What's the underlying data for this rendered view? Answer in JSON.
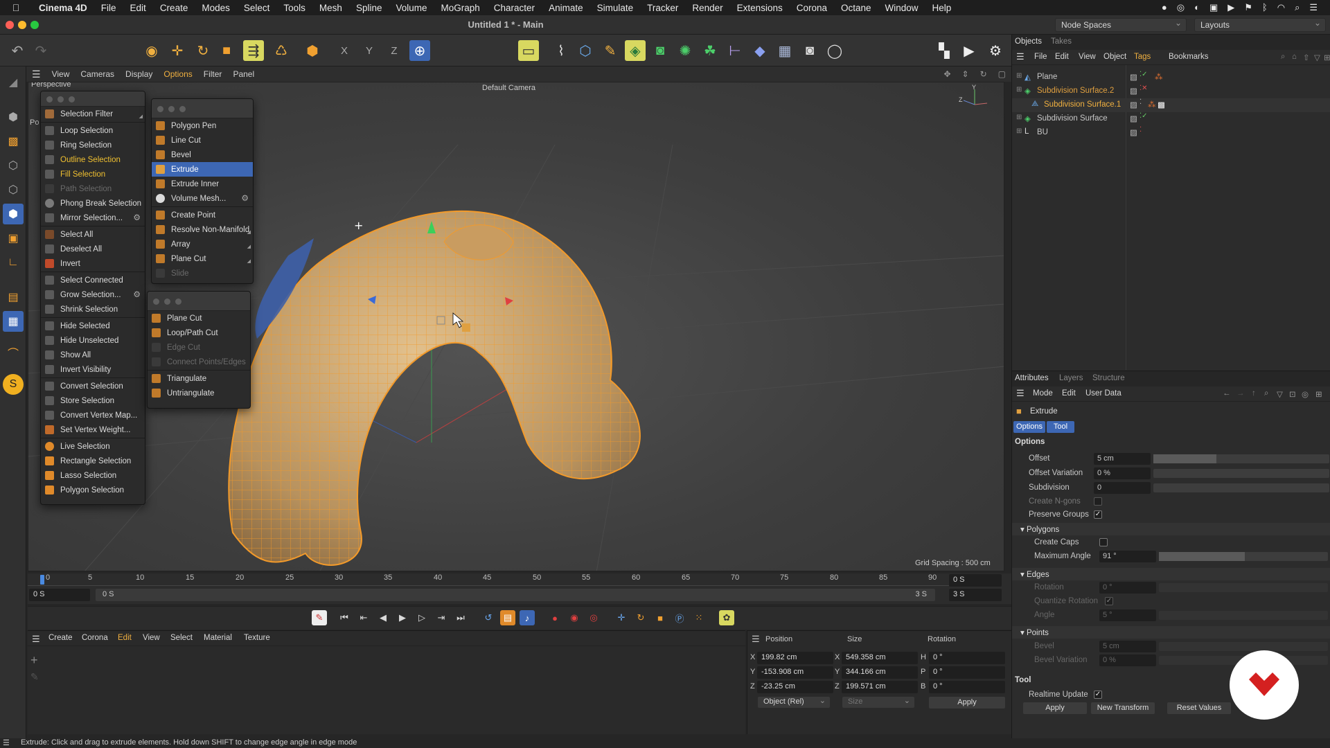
{
  "macmenu": {
    "app": "Cinema 4D",
    "items": [
      "File",
      "Edit",
      "Create",
      "Modes",
      "Select",
      "Tools",
      "Mesh",
      "Spline",
      "Volume",
      "MoGraph",
      "Character",
      "Animate",
      "Simulate",
      "Tracker",
      "Render",
      "Extensions",
      "Corona",
      "Octane",
      "Window",
      "Help"
    ]
  },
  "window": {
    "title": "Untitled 1 * - Main",
    "node_spaces": "Node Spaces",
    "layouts": "Layouts"
  },
  "viewport": {
    "menu": [
      "View",
      "Cameras",
      "Display",
      "Options",
      "Filter",
      "Panel"
    ],
    "label_perspective": "Perspective",
    "label_po": "Po",
    "camera": "Default Camera",
    "grid_spacing": "Grid Spacing : 500 cm"
  },
  "select_menu": {
    "items": [
      "Selection Filter",
      "Loop Selection",
      "Ring Selection",
      "Outline Selection",
      "Fill Selection",
      "Path Selection",
      "Phong Break Selection",
      "Mirror Selection...",
      "Select All",
      "Deselect All",
      "Invert",
      "Select Connected",
      "Grow Selection...",
      "Shrink Selection",
      "Hide Selected",
      "Hide Unselected",
      "Show All",
      "Invert Visibility",
      "Convert Selection",
      "Store Selection",
      "Convert Vertex Map...",
      "Set Vertex Weight...",
      "Live Selection",
      "Rectangle Selection",
      "Lasso Selection",
      "Polygon Selection"
    ]
  },
  "mesh_menu": {
    "items": [
      "Polygon Pen",
      "Line Cut",
      "Bevel",
      "Extrude",
      "Extrude Inner",
      "Volume Mesh...",
      "Create Point",
      "Resolve Non-Manifold",
      "Array",
      "Plane Cut",
      "Slide"
    ]
  },
  "cut_menu": {
    "items": [
      "Plane Cut",
      "Loop/Path Cut",
      "Edge Cut",
      "Connect Points/Edges",
      "Triangulate",
      "Untriangulate"
    ]
  },
  "timeline": {
    "ticks": [
      "0",
      "5",
      "10",
      "15",
      "20",
      "25",
      "30",
      "35",
      "40",
      "45",
      "50",
      "55",
      "60",
      "65",
      "70",
      "75",
      "80",
      "85",
      "90"
    ],
    "current": "0 S",
    "start": "0 S",
    "range_start": "0 S",
    "range_end": "3 S",
    "end": "3 S"
  },
  "material_menu": [
    "Create",
    "Corona",
    "Edit",
    "View",
    "Select",
    "Material",
    "Texture"
  ],
  "coords": {
    "headers": [
      "Position",
      "Size",
      "Rotation"
    ],
    "axes": [
      "X",
      "Y",
      "Z"
    ],
    "rot_axes": [
      "H",
      "P",
      "B"
    ],
    "position": [
      "199.82 cm",
      "-153.908 cm",
      "-23.25 cm"
    ],
    "size": [
      "549.358 cm",
      "344.166 cm",
      "199.571 cm"
    ],
    "rotation": [
      "0 °",
      "0 °",
      "0 °"
    ],
    "mode": "Object (Rel)",
    "size_mode": "Size",
    "apply": "Apply"
  },
  "objects": {
    "tabs": [
      "Objects",
      "Takes"
    ],
    "menu": [
      "File",
      "Edit",
      "View",
      "Object",
      "Tags",
      "Bookmarks"
    ],
    "rows": [
      "Plane",
      "Subdivision Surface.2",
      "Subdivision Surface.1",
      "Subdivision Surface",
      "BU"
    ]
  },
  "attributes": {
    "tabs": [
      "Attributes",
      "Layers",
      "Structure"
    ],
    "menu": [
      "Mode",
      "Edit",
      "User Data"
    ],
    "object": "Extrude",
    "subtabs": [
      "Options",
      "Tool"
    ],
    "options_title": "Options",
    "offset_label": "Offset",
    "offset": "5 cm",
    "offset_fill": 0.36,
    "offset_var_label": "Offset Variation",
    "offset_var": "0 %",
    "subdivision_label": "Subdivision",
    "subdivision": "0",
    "create_ngons": "Create N-gons",
    "preserve_groups": "Preserve Groups",
    "polygons": "Polygons",
    "create_caps": "Create Caps",
    "max_angle_label": "Maximum Angle",
    "max_angle": "91 °",
    "max_angle_fill": 0.51,
    "edges": "Edges",
    "rotation_label": "Rotation",
    "rotation": "0 °",
    "quantize": "Quantize Rotation",
    "angle_label": "Angle",
    "angle": "5 °",
    "points": "Points",
    "bevel_label": "Bevel",
    "bevel": "5 cm",
    "bevel_var_label": "Bevel Variation",
    "bevel_var": "0 %",
    "tool_title": "Tool",
    "realtime": "Realtime Update",
    "btn_apply": "Apply",
    "btn_new": "New Transform",
    "btn_reset": "Reset Values"
  },
  "status": "Extrude: Click and drag to extrude elements. Hold down SHIFT to change edge angle in edge mode",
  "colors": {
    "accent": "#f0b040",
    "selection": "#3d67b4",
    "mesh": "#c9a06a",
    "wire": "#f39a2a"
  }
}
